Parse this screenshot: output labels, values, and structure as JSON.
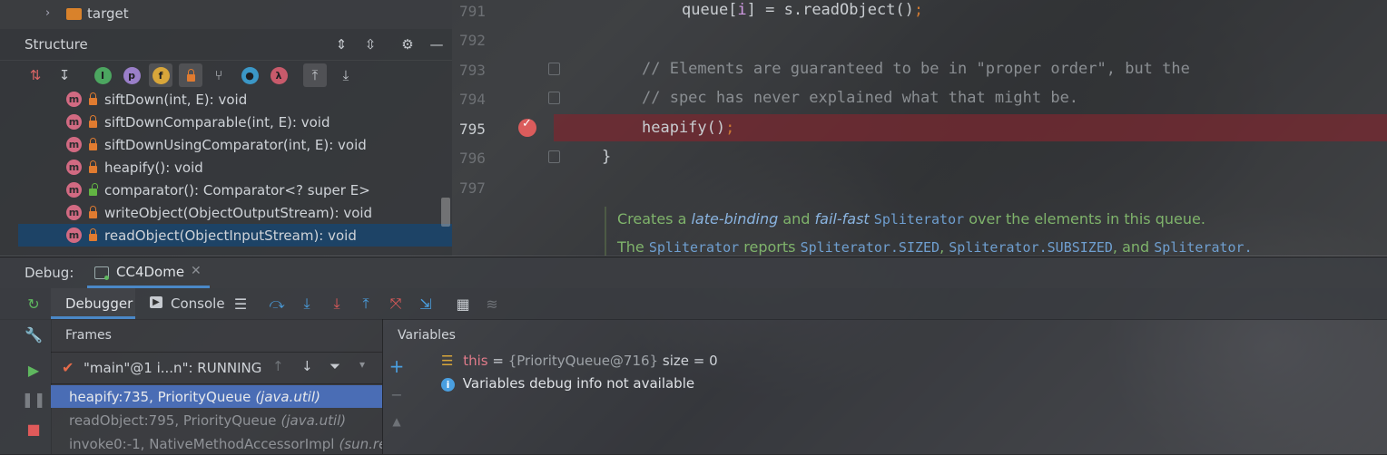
{
  "project_tree": {
    "folder_label": "target"
  },
  "structure": {
    "title": "Structure",
    "toolbar": {
      "sort_type_icon": "sort-by-type-icon",
      "sort_alpha_icon": "sort-alphabetically-icon",
      "inherited": "I",
      "properties": "p",
      "fields": "f",
      "lambda": "λ"
    },
    "methods": [
      {
        "label": "siftDown(int, E): void",
        "locked": true
      },
      {
        "label": "siftDownComparable(int, E): void",
        "locked": true
      },
      {
        "label": "siftDownUsingComparator(int, E): void",
        "locked": true
      },
      {
        "label": "heapify(): void",
        "locked": true
      },
      {
        "label": "comparator(): Comparator<? super E>",
        "locked": false
      },
      {
        "label": "writeObject(ObjectOutputStream): void",
        "locked": true
      },
      {
        "label": "readObject(ObjectInputStream): void",
        "locked": true,
        "selected": true
      }
    ],
    "method_icon_letter": "m"
  },
  "editor": {
    "lines": [
      {
        "no": "791",
        "text_a": "queue[",
        "var": "i",
        "text_b": "] = s.readObject()",
        "semi": ";"
      },
      {
        "no": "792"
      },
      {
        "no": "793",
        "comment": "// Elements are guaranteed to be in \"proper order\", but the"
      },
      {
        "no": "794",
        "comment": "// spec has never explained what that might be."
      },
      {
        "no": "795",
        "text": "heapify()",
        "semi": ";"
      },
      {
        "no": "796",
        "text": "}"
      },
      {
        "no": "797"
      }
    ],
    "doc": {
      "l1_a": "Creates a ",
      "l1_i1": "late-binding",
      "l1_b": " and ",
      "l1_i2": "fail-fast",
      "l1_m1": "Spliterator",
      "l1_c": " over the elements in this queue.",
      "l2_a": "The ",
      "l2_m1": "Spliterator",
      "l2_b": " reports ",
      "l2_m2": "Spliterator.SIZED",
      "l2_c": ", ",
      "l2_m3": "Spliterator.SUBSIZED",
      "l2_d": ", and ",
      "l2_m4": "Spliterator."
    }
  },
  "debug": {
    "label": "Debug:",
    "session_tab": "CC4Dome",
    "tabs": {
      "debugger": "Debugger",
      "console": "Console"
    },
    "frames_title": "Frames",
    "variables_title": "Variables",
    "thread": "\"main\"@1 i...n\": RUNNING",
    "frames": [
      {
        "method": "heapify:735, PriorityQueue",
        "pkg": "(java.util)"
      },
      {
        "method": "readObject:795, PriorityQueue",
        "pkg": "(java.util)"
      },
      {
        "method": "invoke0:-1, NativeMethodAccessorImpl",
        "pkg": "(sun.re"
      }
    ],
    "variables": {
      "this_name": "this",
      "this_eq": " = ",
      "this_value": "{PriorityQueue@716}",
      "this_extra": " size = 0",
      "info": "Variables debug info not available"
    }
  },
  "colors": {
    "accent": "#4a6db5",
    "selection": "#1d4366",
    "breakpoint": "#db5c5c"
  }
}
